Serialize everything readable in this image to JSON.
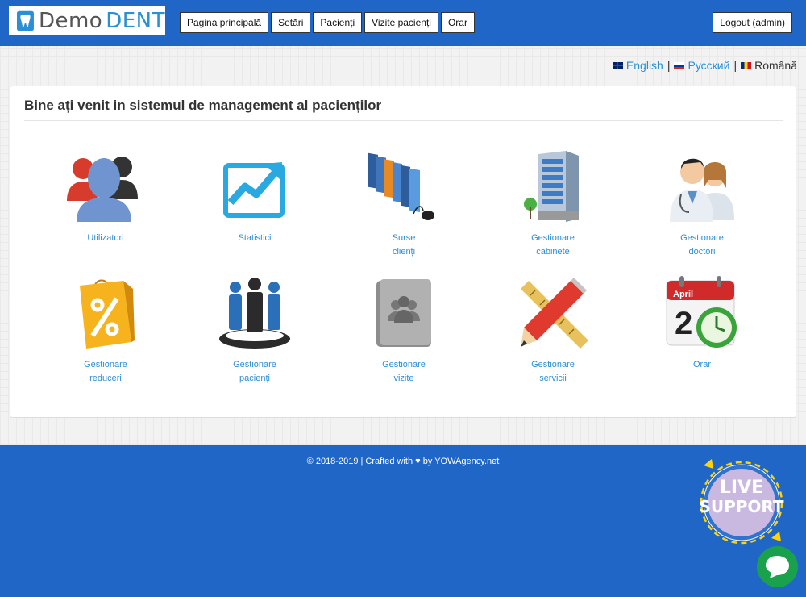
{
  "brand": {
    "prefix": "Demo",
    "name": "DENT"
  },
  "nav": [
    {
      "label": "Pagina principală"
    },
    {
      "label": "Setări"
    },
    {
      "label": "Pacienți"
    },
    {
      "label": "Vizite pacienți"
    },
    {
      "label": "Orar"
    }
  ],
  "logout": "Logout (admin)",
  "languages": {
    "english": "English",
    "russian": "Русский",
    "romanian": "Română",
    "separator": "|"
  },
  "panel": {
    "title": "Bine ați venit in sistemul de management al pacienților"
  },
  "tiles": [
    {
      "label": "Utilizatori",
      "icon": "users-icon"
    },
    {
      "label": "Statistici",
      "icon": "statistics-chart-icon"
    },
    {
      "label": "Surse\nclienți",
      "icon": "folders-mouse-icon"
    },
    {
      "label": "Gestionare\ncabinete",
      "icon": "building-icon"
    },
    {
      "label": "Gestionare\ndoctori",
      "icon": "doctors-icon"
    },
    {
      "label": "Gestionare\nreduceri",
      "icon": "discount-bag-icon"
    },
    {
      "label": "Gestionare\npacienți",
      "icon": "patients-group-icon"
    },
    {
      "label": "Gestionare\nvizite",
      "icon": "contacts-folder-icon"
    },
    {
      "label": "Gestionare\nservicii",
      "icon": "ruler-pencil-icon"
    },
    {
      "label": "Orar",
      "icon": "calendar-clock-icon"
    }
  ],
  "calendar": {
    "month": "April",
    "day": "2"
  },
  "footer": {
    "text": "© 2018-2019 | Crafted with ♥ by YOWAgency.net"
  },
  "live_support": {
    "line1": "LIVE",
    "line2": "SUPPORT"
  },
  "colors": {
    "header": "#2066c6",
    "link": "#2b8fd6",
    "chat": "#1aa14b"
  }
}
